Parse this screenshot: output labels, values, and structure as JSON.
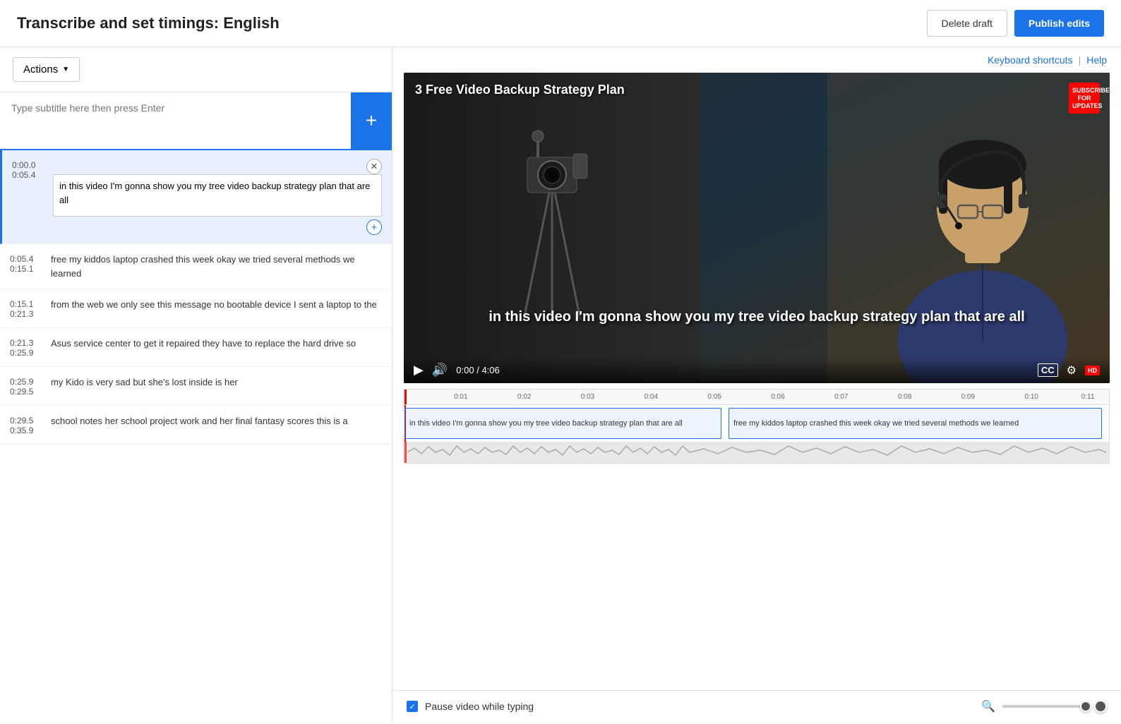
{
  "header": {
    "title": "Transcribe and set timings: English",
    "delete_draft_label": "Delete draft",
    "publish_edits_label": "Publish edits"
  },
  "toolbar": {
    "actions_label": "Actions",
    "keyboard_shortcuts_label": "Keyboard shortcuts",
    "help_label": "Help"
  },
  "subtitle_input": {
    "placeholder": "Type subtitle here then press Enter",
    "add_button_label": "+"
  },
  "captions": [
    {
      "id": "cap1",
      "start": "0:00.0",
      "end": "0:05.4",
      "text": "in this video I'm gonna show you my tree video backup strategy plan that are all",
      "active": true
    },
    {
      "id": "cap2",
      "start": "0:05.4",
      "end": "0:15.1",
      "text": "free my kiddos laptop crashed this week okay we tried several methods we learned",
      "active": false
    },
    {
      "id": "cap3",
      "start": "0:15.1",
      "end": "0:21.3",
      "text": "from the web we only see this message no bootable device I sent a laptop to the",
      "active": false
    },
    {
      "id": "cap4",
      "start": "0:21.3",
      "end": "0:25.9",
      "text": "Asus service center to get it repaired they have to replace the hard drive so",
      "active": false
    },
    {
      "id": "cap5",
      "start": "0:25.9",
      "end": "0:29.5",
      "text": "my Kido is very sad but she's lost inside is her",
      "active": false
    },
    {
      "id": "cap6",
      "start": "0:29.5",
      "end": "0:35.9",
      "text": "school notes her school project work and her final fantasy scores this is a",
      "active": false
    }
  ],
  "video": {
    "title": "3 Free Video Backup Strategy Plan",
    "caption_overlay": "in this video I'm gonna show you my tree video backup strategy plan that are all",
    "time_current": "0:00",
    "time_total": "4:06",
    "subscribe_line1": "SUBSCRIBE",
    "subscribe_line2": "FOR",
    "subscribe_line3": "UPDATES",
    "hd_badge": "HD"
  },
  "timeline": {
    "ticks": [
      "0:01",
      "0:02",
      "0:03",
      "0:04",
      "0:05",
      "0:06",
      "0:07",
      "0:08",
      "0:09",
      "0:10",
      "0:11"
    ],
    "caption_blocks": [
      {
        "text": "in this video I'm gonna show you my tree video backup strategy plan that are all",
        "left_pct": 0,
        "width_pct": 46
      },
      {
        "text": "free my kiddos laptop crashed this week okay we tried several methods we learned",
        "left_pct": 46,
        "width_pct": 54
      }
    ]
  },
  "bottom_bar": {
    "pause_label": "Pause video while typing",
    "pause_checked": true
  }
}
